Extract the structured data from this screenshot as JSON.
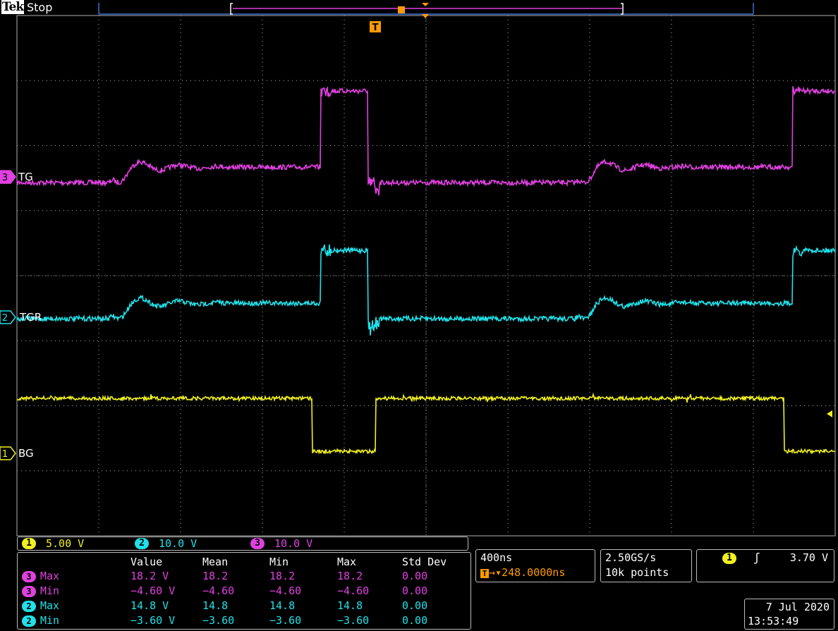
{
  "topbar": {
    "brand": "Tek",
    "state": "Stop",
    "trigger_marker": "T"
  },
  "channels": [
    {
      "id": "3",
      "label": "TG",
      "color": "#e040e0"
    },
    {
      "id": "2",
      "label": "TGR",
      "color": "#20e0e8"
    },
    {
      "id": "1",
      "label": "BG",
      "color": "#f0f020"
    }
  ],
  "scales": [
    {
      "ch": "1",
      "value": "5.00 V",
      "color": "#f0f020"
    },
    {
      "ch": "2",
      "value": "10.0 V",
      "color": "#20e0e8"
    },
    {
      "ch": "3",
      "value": "10.0 V",
      "color": "#e040e0"
    }
  ],
  "measurements": {
    "headers": [
      "Value",
      "Mean",
      "Min",
      "Max",
      "Std Dev"
    ],
    "rows": [
      {
        "ch": "3",
        "type": "Max",
        "color": "#e040e0",
        "value": "18.2 V",
        "mean": "18.2",
        "min": "18.2",
        "max": "18.2",
        "std": "0.00"
      },
      {
        "ch": "3",
        "type": "Min",
        "color": "#e040e0",
        "value": "−4.60 V",
        "mean": "−4.60",
        "min": "−4.60",
        "max": "−4.60",
        "std": "0.00"
      },
      {
        "ch": "2",
        "type": "Max",
        "color": "#20e0e8",
        "value": "14.8 V",
        "mean": "14.8",
        "min": "14.8",
        "max": "14.8",
        "std": "0.00"
      },
      {
        "ch": "2",
        "type": "Min",
        "color": "#20e0e8",
        "value": "−3.60 V",
        "mean": "−3.60",
        "min": "−3.60",
        "max": "−3.60",
        "std": "0.00"
      }
    ]
  },
  "horizontal": {
    "timebase": "400ns",
    "trigger_pos": "248.0000ns"
  },
  "acquisition": {
    "rate": "2.50GS/s",
    "points": "10k points"
  },
  "trigger": {
    "ch": "1",
    "slope_icon": "rising-edge-icon",
    "level": "3.70 V"
  },
  "datetime": {
    "date": "7 Jul  2020",
    "time": "13:53:49"
  },
  "colors": {
    "grid": "#b0b0b0",
    "trigger": "#ff9a00",
    "bezel": "#3a6fd8"
  },
  "chart_data": {
    "type": "line",
    "x_divisions": 10,
    "y_divisions": 8,
    "series": [
      {
        "name": "TG",
        "values": [
          -4.6,
          18.2
        ]
      },
      {
        "name": "TGR",
        "values": [
          -3.6,
          14.8
        ]
      },
      {
        "name": "BG",
        "values": []
      }
    ]
  }
}
